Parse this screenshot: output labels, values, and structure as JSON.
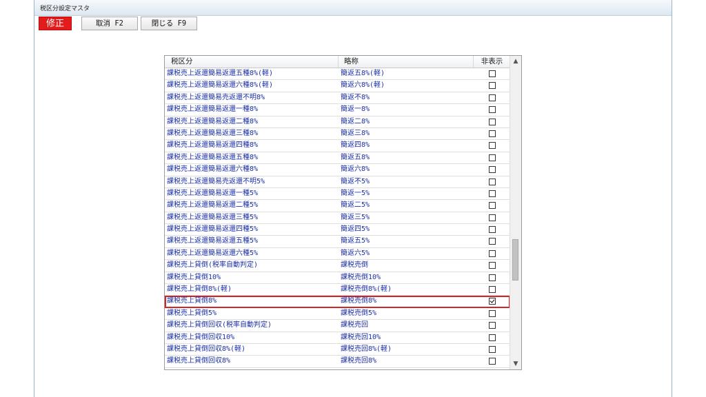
{
  "window": {
    "title": "税区分設定マスタ",
    "mode_badge": "修正",
    "buttons": {
      "cancel": "取消 F2",
      "close": "閉じる F9"
    }
  },
  "grid": {
    "columns": [
      "税区分",
      "略称",
      "非表示"
    ],
    "rows": [
      {
        "name": "課税売上返還簡易返還五種8%(軽)",
        "abbr": "簡返五8%(軽)",
        "hidden": false
      },
      {
        "name": "課税売上返還簡易返還六種8%(軽)",
        "abbr": "簡返六8%(軽)",
        "hidden": false
      },
      {
        "name": "課税売上返還簡易売返還不明8%",
        "abbr": "簡返不8%",
        "hidden": false
      },
      {
        "name": "課税売上返還簡易返還一種8%",
        "abbr": "簡返一8%",
        "hidden": false
      },
      {
        "name": "課税売上返還簡易返還二種8%",
        "abbr": "簡返二8%",
        "hidden": false
      },
      {
        "name": "課税売上返還簡易返還三種8%",
        "abbr": "簡返三8%",
        "hidden": false
      },
      {
        "name": "課税売上返還簡易返還四種8%",
        "abbr": "簡返四8%",
        "hidden": false
      },
      {
        "name": "課税売上返還簡易返還五種8%",
        "abbr": "簡返五8%",
        "hidden": false
      },
      {
        "name": "課税売上返還簡易返還六種8%",
        "abbr": "簡返六8%",
        "hidden": false
      },
      {
        "name": "課税売上返還簡易売返還不明5%",
        "abbr": "簡返不5%",
        "hidden": false
      },
      {
        "name": "課税売上返還簡易返還一種5%",
        "abbr": "簡返一5%",
        "hidden": false
      },
      {
        "name": "課税売上返還簡易返還二種5%",
        "abbr": "簡返二5%",
        "hidden": false
      },
      {
        "name": "課税売上返還簡易返還三種5%",
        "abbr": "簡返三5%",
        "hidden": false
      },
      {
        "name": "課税売上返還簡易返還四種5%",
        "abbr": "簡返四5%",
        "hidden": false
      },
      {
        "name": "課税売上返還簡易返還五種5%",
        "abbr": "簡返五5%",
        "hidden": false
      },
      {
        "name": "課税売上返還簡易返還六種5%",
        "abbr": "簡返六5%",
        "hidden": false
      },
      {
        "name": "課税売上貸倒(税率自動判定)",
        "abbr": "課税売倒",
        "hidden": false
      },
      {
        "name": "課税売上貸倒10%",
        "abbr": "課税売倒10%",
        "hidden": false
      },
      {
        "name": "課税売上貸倒8%(軽)",
        "abbr": "課税売倒8%(軽)",
        "hidden": false
      },
      {
        "name": "課税売上貸倒8%",
        "abbr": "課税売倒8%",
        "hidden": true,
        "selected": true
      },
      {
        "name": "課税売上貸倒5%",
        "abbr": "課税売倒5%",
        "hidden": false
      },
      {
        "name": "課税売上貸倒回収(税率自動判定)",
        "abbr": "課税売回",
        "hidden": false
      },
      {
        "name": "課税売上貸倒回収10%",
        "abbr": "課税売回10%",
        "hidden": false
      },
      {
        "name": "課税売上貸倒回収8%(軽)",
        "abbr": "課税売回8%(軽)",
        "hidden": false
      },
      {
        "name": "課税売上貸倒回収8%",
        "abbr": "課税売回8%",
        "hidden": false
      }
    ]
  },
  "icons": {
    "scroll_up": "chevron-up-icon",
    "scroll_down": "chevron-down-icon"
  }
}
